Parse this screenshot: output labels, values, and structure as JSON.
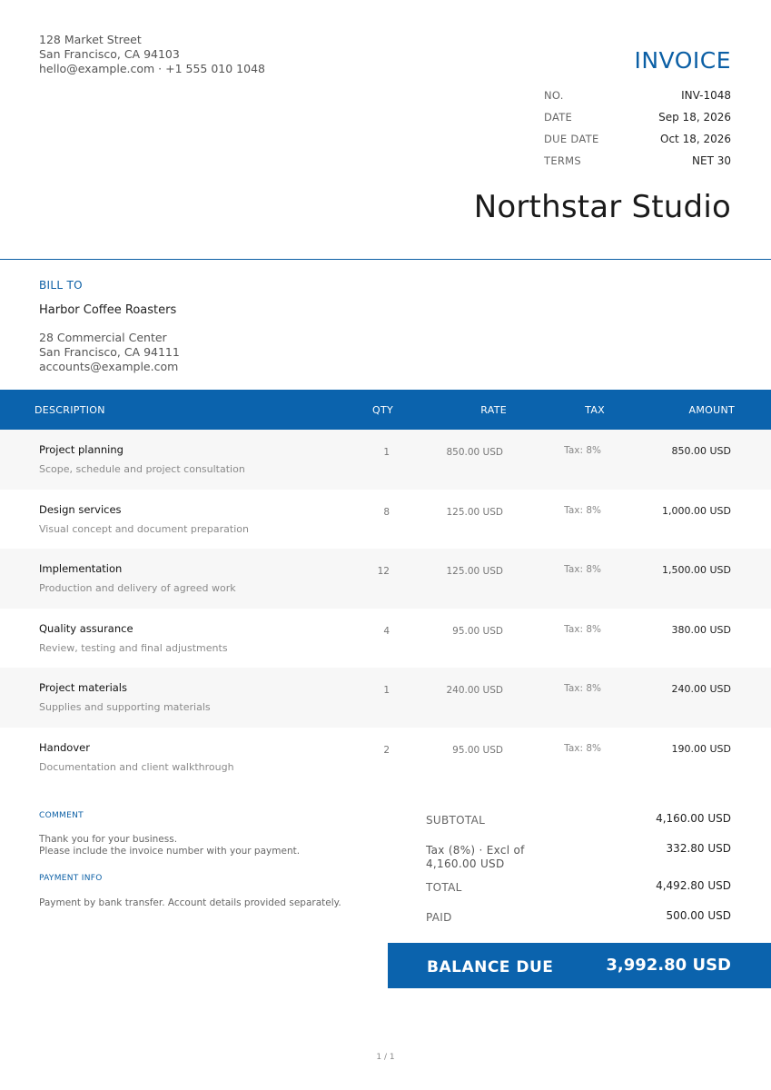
{
  "sender": {
    "street": "128 Market Street",
    "city": "San Francisco, CA 94103",
    "contact": "hello@example.com · +1 555 010 1048"
  },
  "invoice": {
    "title": "INVOICE",
    "meta": [
      {
        "label": "NO.",
        "value": "INV-1048"
      },
      {
        "label": "DATE",
        "value": "Sep 18, 2026"
      },
      {
        "label": "DUE DATE",
        "value": "Oct 18, 2026"
      },
      {
        "label": "TERMS",
        "value": "NET 30"
      }
    ],
    "company": "Northstar Studio"
  },
  "bill_to": {
    "label": "BILL TO",
    "name": "Harbor Coffee Roasters",
    "address1": "28 Commercial Center",
    "address2": "San Francisco, CA 94111",
    "email": "accounts@example.com"
  },
  "table": {
    "headers": {
      "description": "DESCRIPTION",
      "qty": "QTY",
      "rate": "RATE",
      "tax": "TAX",
      "amount": "AMOUNT"
    },
    "rows": [
      {
        "desc": "Project planning",
        "sub": "Scope, schedule and project consultation",
        "qty": "1",
        "rate": "850.00 USD",
        "tax": "Tax: 8%",
        "amount": "850.00 USD"
      },
      {
        "desc": "Design services",
        "sub": "Visual concept and document preparation",
        "qty": "8",
        "rate": "125.00 USD",
        "tax": "Tax: 8%",
        "amount": "1,000.00 USD"
      },
      {
        "desc": "Implementation",
        "sub": "Production and delivery of agreed work",
        "qty": "12",
        "rate": "125.00 USD",
        "tax": "Tax: 8%",
        "amount": "1,500.00 USD"
      },
      {
        "desc": "Quality assurance",
        "sub": "Review, testing and final adjustments",
        "qty": "4",
        "rate": "95.00 USD",
        "tax": "Tax: 8%",
        "amount": "380.00 USD"
      },
      {
        "desc": "Project materials",
        "sub": "Supplies and supporting materials",
        "qty": "1",
        "rate": "240.00 USD",
        "tax": "Tax: 8%",
        "amount": "240.00 USD"
      },
      {
        "desc": "Handover",
        "sub": "Documentation and client walkthrough",
        "qty": "2",
        "rate": "95.00 USD",
        "tax": "Tax: 8%",
        "amount": "190.00 USD"
      }
    ]
  },
  "comment": {
    "label": "COMMENT",
    "line1": "Thank you for your business.",
    "line2": "Please include the invoice number with your payment."
  },
  "payment": {
    "label": "PAYMENT INFO",
    "text": "Payment by bank transfer. Account details provided separately."
  },
  "totals": {
    "subtotal_label": "SUBTOTAL",
    "subtotal": "4,160.00 USD",
    "tax_label_1": "Tax (8%) · Excl of",
    "tax_label_2": "4,160.00 USD",
    "tax": "332.80 USD",
    "total_label": "TOTAL",
    "total": "4,492.80 USD",
    "paid_label": "PAID",
    "paid": "500.00 USD",
    "balance_label": "BALANCE DUE",
    "balance": "3,992.80 USD"
  },
  "page": "1 / 1",
  "colors": {
    "accent": "#0b63ad",
    "row_shade": "#f7f7f7"
  }
}
